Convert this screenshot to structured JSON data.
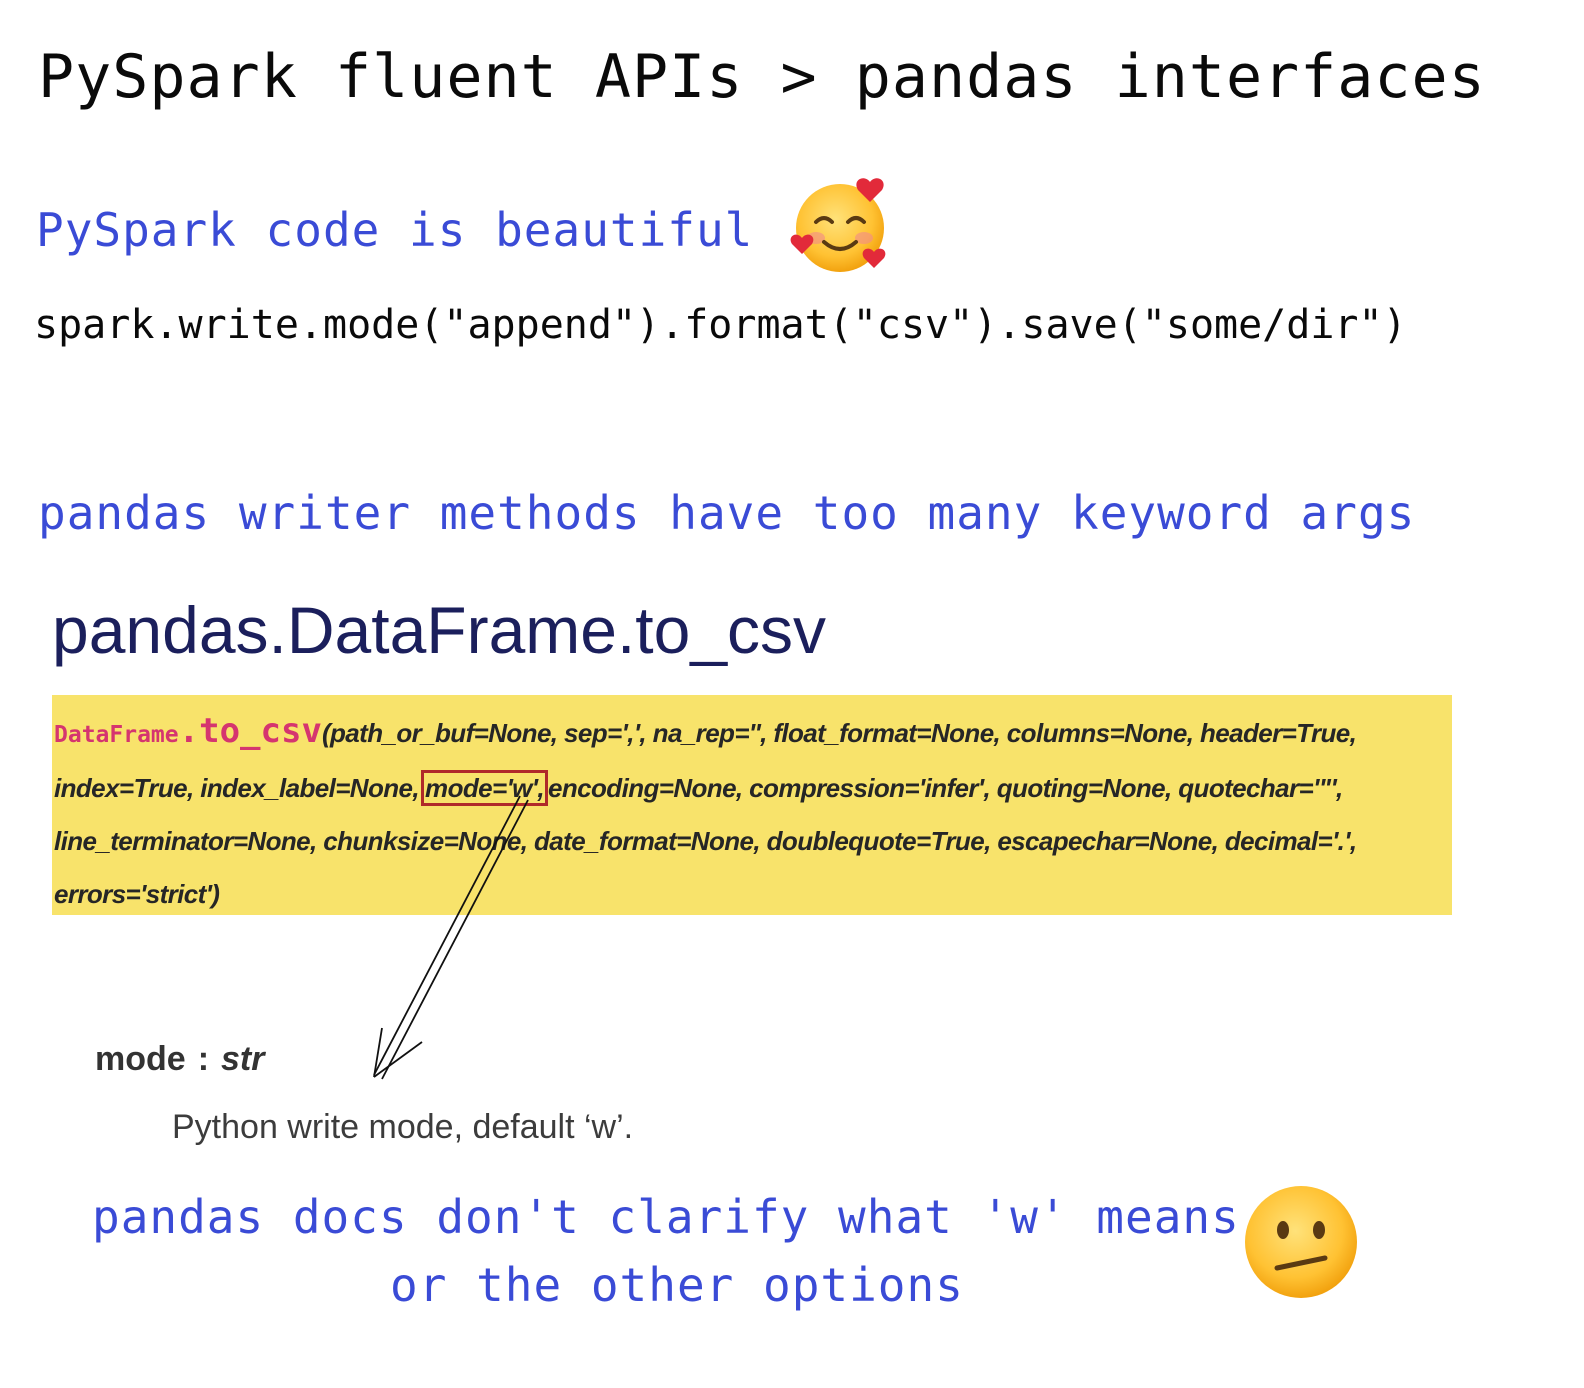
{
  "title": "PySpark fluent APIs > pandas interfaces",
  "section1": {
    "heading": "PySpark code is beautiful",
    "heading_emoji": "smiling-face-with-hearts",
    "code": "spark.write.mode(\"append\").format(\"csv\").save(\"some/dir\")"
  },
  "section2": {
    "heading": "pandas writer methods have too many keyword args",
    "api_title": "pandas.DataFrame.to_csv",
    "signature": {
      "class_name": "DataFrame",
      "dot": ".",
      "method": "to_csv",
      "open_paren": "(",
      "line1": "path_or_buf=None, sep=',', na_rep='', float_format=None, columns=None, header=True,",
      "line2_pre": "index=True, index_label=None,",
      "highlighted_param": "mode='w',",
      "line2_post": "encoding=None, compression='infer', quoting=None, quotechar='\"',",
      "line3": "line_terminator=None, chunksize=None, date_format=None, doublequote=True, escapechar=None, decimal='.',",
      "line4": "errors='strict')"
    },
    "param_doc": {
      "name": "mode",
      "separator": ":",
      "type": "str",
      "description": "Python write mode, default ‘w’."
    }
  },
  "section3": {
    "line1": "pandas docs don't clarify what 'w' means",
    "line2": "or the other options",
    "emoji": "neutral-face"
  },
  "colors": {
    "handwriting_blue": "#3a4bd6",
    "highlight_yellow": "#f8e36b",
    "method_pink": "#d5356f",
    "annotation_red": "#b02a2a",
    "title_navy": "#1b1f5c"
  }
}
